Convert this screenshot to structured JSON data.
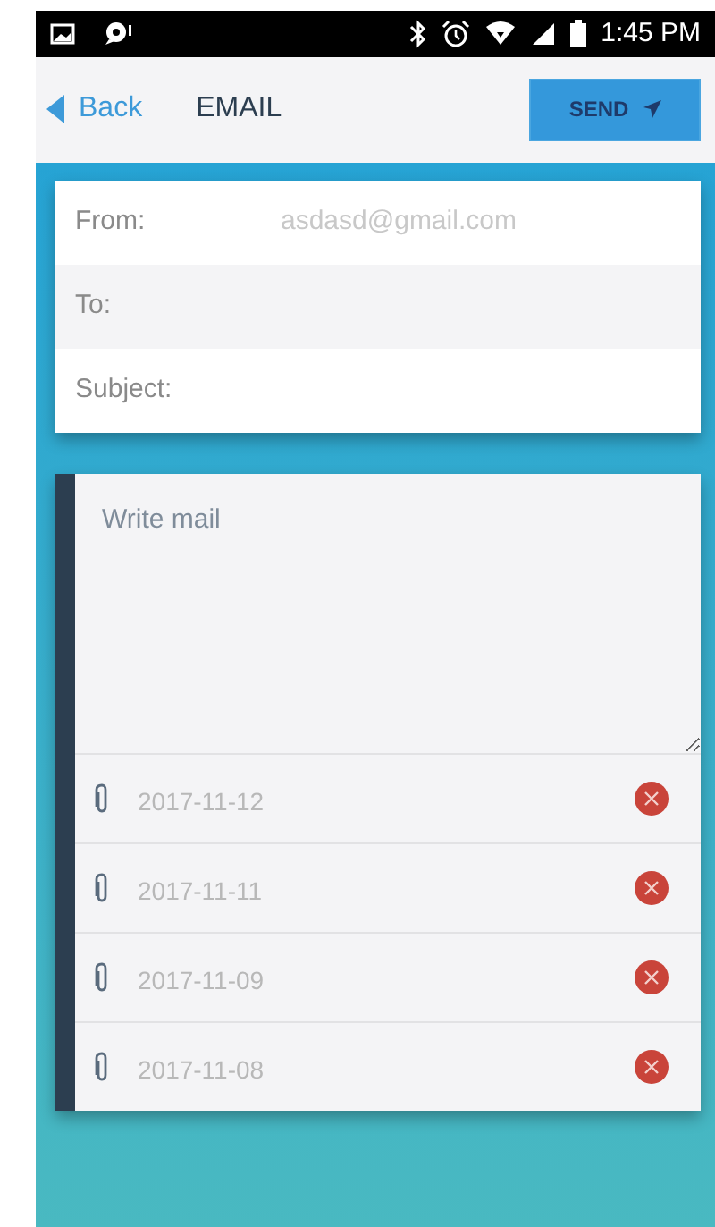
{
  "status_bar": {
    "time": "1:45 PM"
  },
  "header": {
    "back": "Back",
    "title": "EMAIL",
    "send": "SEND"
  },
  "form": {
    "fields": [
      {
        "label": "From:",
        "value": "asdasd@gmail.com"
      },
      {
        "label": "To:"
      },
      {
        "label": "Subject:"
      }
    ]
  },
  "message": {
    "placeholder": "Write mail"
  },
  "attachments": [
    {
      "name": "2017-11-12"
    },
    {
      "name": "2017-11-11"
    },
    {
      "name": "2017-11-09"
    },
    {
      "name": "2017-11-08"
    }
  ]
}
